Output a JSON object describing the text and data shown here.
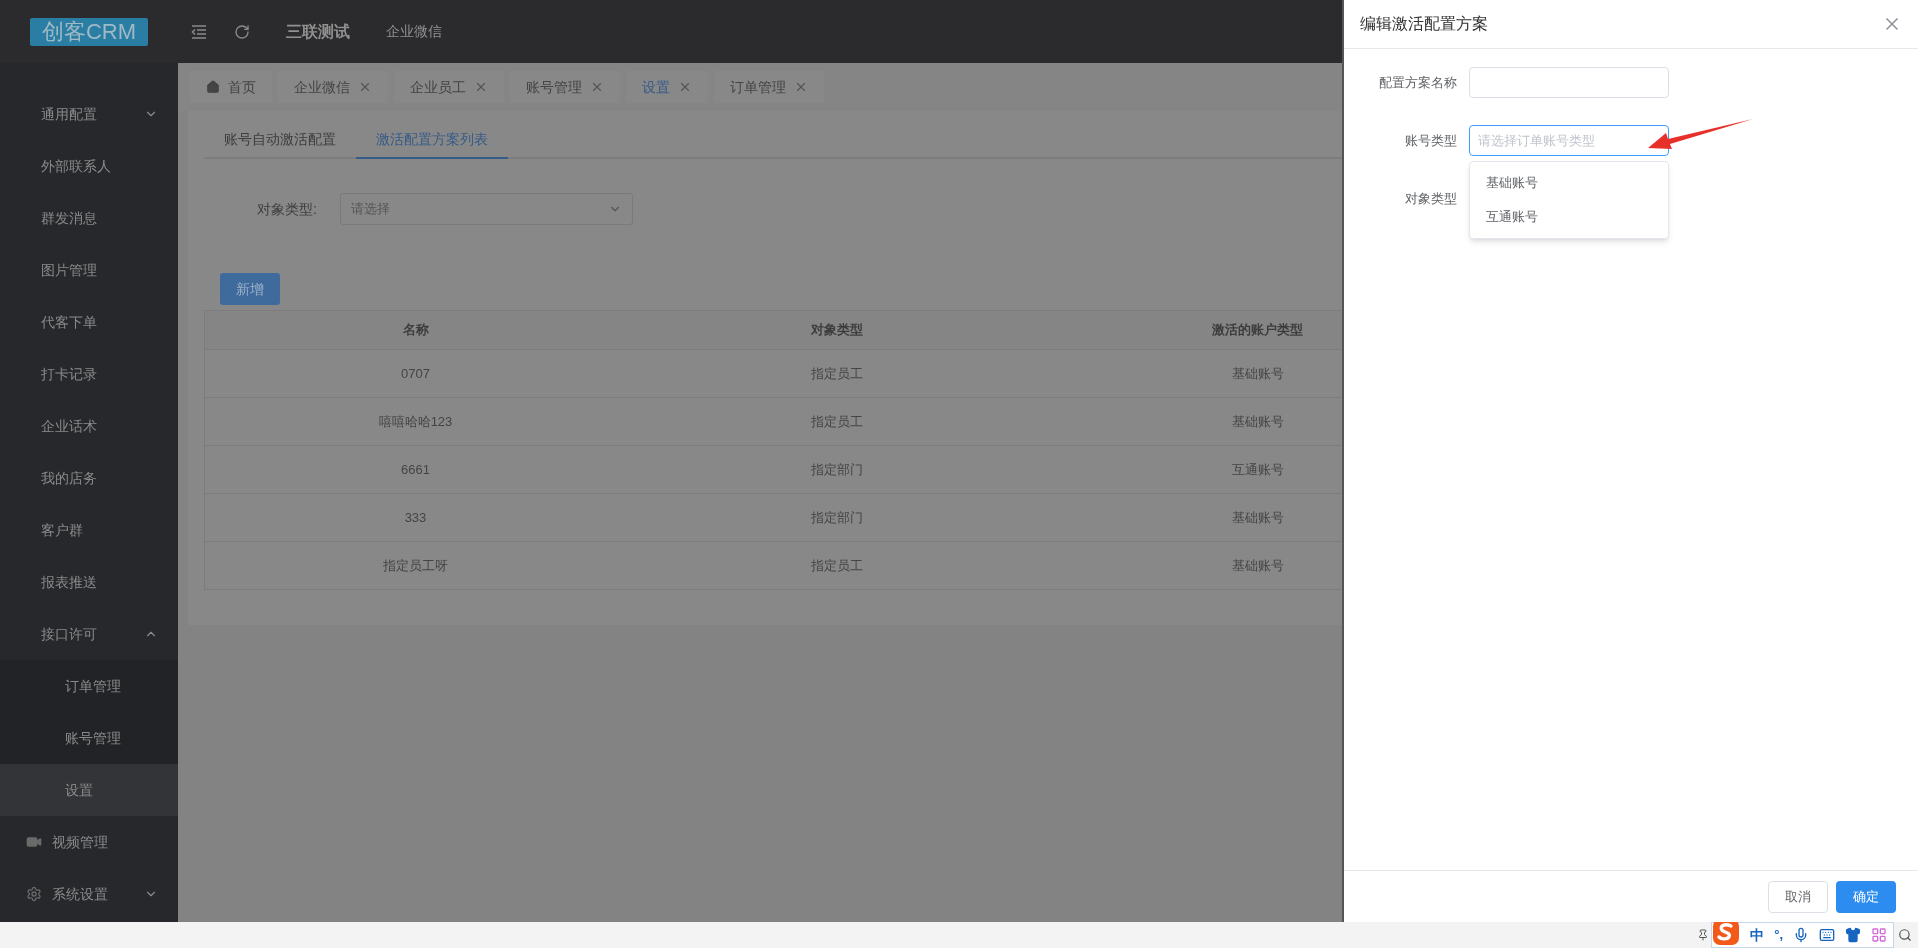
{
  "header": {
    "logo": "创客CRM",
    "title": "三联测试",
    "link": "企业微信"
  },
  "sidebar": {
    "items": [
      {
        "label": "通用配置",
        "kind": "group",
        "expanded": false
      },
      {
        "label": "外部联系人",
        "kind": "link"
      },
      {
        "label": "群发消息",
        "kind": "link"
      },
      {
        "label": "图片管理",
        "kind": "link"
      },
      {
        "label": "代客下单",
        "kind": "link"
      },
      {
        "label": "打卡记录",
        "kind": "link"
      },
      {
        "label": "企业话术",
        "kind": "link"
      },
      {
        "label": "我的店务",
        "kind": "link"
      },
      {
        "label": "客户群",
        "kind": "link"
      },
      {
        "label": "报表推送",
        "kind": "link"
      },
      {
        "label": "接口许可",
        "kind": "group",
        "expanded": true,
        "children": [
          {
            "label": "订单管理",
            "selected": false
          },
          {
            "label": "账号管理",
            "selected": false
          },
          {
            "label": "设置",
            "selected": true
          }
        ]
      },
      {
        "label": "视频管理",
        "kind": "media"
      },
      {
        "label": "系统设置",
        "kind": "system",
        "expanded": false
      }
    ]
  },
  "tags": [
    {
      "label": "首页",
      "kind": "home",
      "selected": false
    },
    {
      "label": "企业微信",
      "kind": "closable",
      "selected": false
    },
    {
      "label": "企业员工",
      "kind": "closable",
      "selected": false
    },
    {
      "label": "账号管理",
      "kind": "closable",
      "selected": false
    },
    {
      "label": "设置",
      "kind": "closable",
      "selected": true
    },
    {
      "label": "订单管理",
      "kind": "closable",
      "selected": false
    }
  ],
  "tabs": [
    {
      "label": "账号自动激活配置",
      "selected": false
    },
    {
      "label": "激活配置方案列表",
      "selected": true
    }
  ],
  "filter": {
    "label": "对象类型:",
    "placeholder": "请选择"
  },
  "add_button": "新增",
  "table": {
    "columns": [
      "名称",
      "对象类型",
      "激活的账户类型"
    ],
    "rows": [
      [
        "0707",
        "指定员工",
        "基础账号"
      ],
      [
        "嘻嘻哈哈123",
        "指定员工",
        "基础账号"
      ],
      [
        "6661",
        "指定部门",
        "互通账号"
      ],
      [
        "333",
        "指定部门",
        "基础账号"
      ],
      [
        "指定员工呀",
        "指定员工",
        "基础账号"
      ]
    ]
  },
  "drawer": {
    "title": "编辑激活配置方案",
    "fields": [
      {
        "label": "配置方案名称",
        "kind": "input"
      },
      {
        "label": "账号类型",
        "kind": "select",
        "placeholder": "请选择订单账号类型",
        "focused": true,
        "options": [
          "基础账号",
          "互通账号"
        ]
      },
      {
        "label": "对象类型",
        "kind": "covered"
      }
    ],
    "buttons": [
      {
        "label": "取消",
        "kind": "default"
      },
      {
        "label": "确定",
        "kind": "primary"
      }
    ]
  },
  "ime": {
    "mode": "中",
    "punct": "°,"
  }
}
